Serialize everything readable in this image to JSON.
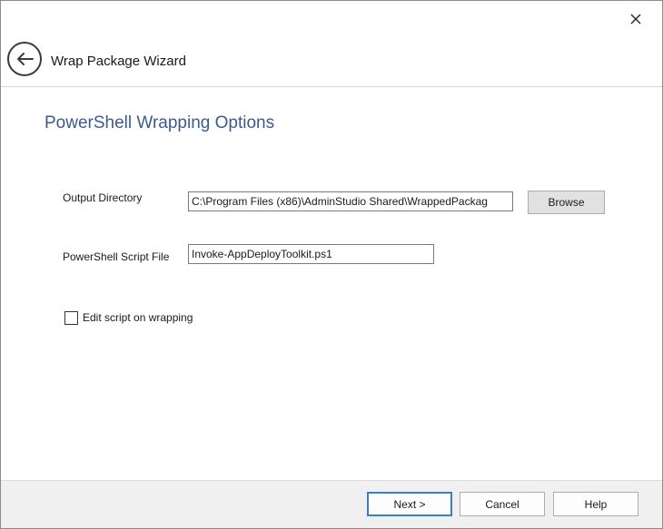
{
  "window": {
    "title": "Wrap Package Wizard"
  },
  "page": {
    "title": "PowerShell Wrapping Options"
  },
  "form": {
    "output_directory": {
      "label": "Output Directory",
      "value": "C:\\Program Files (x86)\\AdminStudio Shared\\WrappedPackag",
      "browse_label": "Browse"
    },
    "script_file": {
      "label": "PowerShell Script File",
      "value": "Invoke-AppDeployToolkit.ps1"
    },
    "edit_script": {
      "label": "Edit script on wrapping",
      "checked": false
    }
  },
  "footer": {
    "next_label": "Next >",
    "cancel_label": "Cancel",
    "help_label": "Help"
  },
  "icons": {
    "close": "close-icon",
    "back": "back-arrow-icon"
  },
  "colors": {
    "page_title": "#3c5a8c",
    "default_button_border": "#3c7fc1",
    "footer_bg": "#f0f0f0"
  }
}
